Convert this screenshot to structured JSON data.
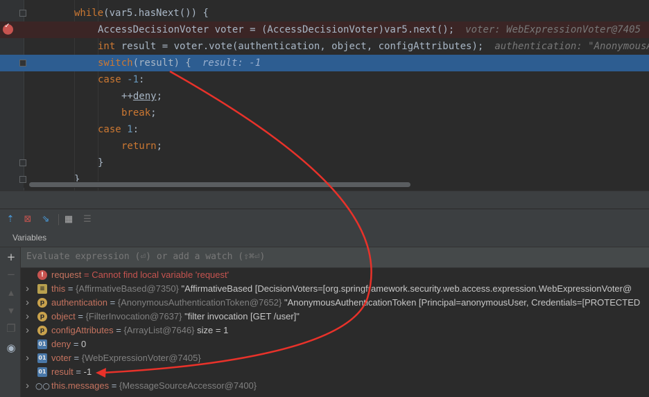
{
  "editor": {
    "lines": [
      {
        "indent": 0,
        "parts": [
          {
            "t": "while",
            "c": "kw"
          },
          {
            "t": "(var5.hasNext()) {"
          }
        ]
      },
      {
        "indent": 1,
        "parts": [
          {
            "t": "AccessDecisionVoter voter = (AccessDecisionVoter)var5.next();"
          }
        ],
        "hint": "voter: WebExpressionVoter@7405"
      },
      {
        "indent": 1,
        "parts": [
          {
            "t": "int",
            "c": "kw"
          },
          {
            "t": " result = voter.vote(authentication, object, configAttributes);"
          }
        ],
        "hint": "authentication: \"AnonymousAuthenticationToken"
      },
      {
        "indent": 1,
        "parts": [
          {
            "t": "switch",
            "c": "kw"
          },
          {
            "t": "(result) {"
          }
        ],
        "hint": "result: -1"
      },
      {
        "indent": 1,
        "parts": [
          {
            "t": "case ",
            "c": "kw"
          },
          {
            "t": "-1",
            "c": "num"
          },
          {
            "t": ":"
          }
        ]
      },
      {
        "indent": 2,
        "parts": [
          {
            "t": "++"
          },
          {
            "t": "deny",
            "c": "fld"
          },
          {
            "t": ";"
          }
        ]
      },
      {
        "indent": 2,
        "parts": [
          {
            "t": "break",
            "c": "kw"
          },
          {
            "t": ";"
          }
        ]
      },
      {
        "indent": 1,
        "parts": [
          {
            "t": "case ",
            "c": "kw"
          },
          {
            "t": "1",
            "c": "num"
          },
          {
            "t": ":"
          }
        ]
      },
      {
        "indent": 2,
        "parts": [
          {
            "t": "return",
            "c": "kw"
          },
          {
            "t": ";"
          }
        ]
      },
      {
        "indent": 1,
        "parts": [
          {
            "t": "}"
          }
        ]
      },
      {
        "indent": 0,
        "parts": [
          {
            "t": "}"
          }
        ]
      }
    ]
  },
  "toolbar": {
    "icons": [
      "step-out-icon",
      "drop-frame-icon",
      "run-to-cursor-icon",
      "evaluate-table-icon",
      "trace-icon"
    ],
    "glyphs": [
      "⇡",
      "⊠",
      "⇘",
      "▦",
      "☰"
    ]
  },
  "variables": {
    "header": "Variables",
    "eval_placeholder": "Evaluate expression (⏎) or add a watch (⇧⌘⏎)",
    "side_icons": [
      {
        "name": "add-watch-icon",
        "glyph": "+"
      },
      {
        "name": "remove-watch-icon",
        "glyph": "−"
      },
      {
        "name": "move-up-icon",
        "glyph": "▴"
      },
      {
        "name": "move-down-icon",
        "glyph": "▾"
      },
      {
        "name": "copy-icon",
        "glyph": "❐"
      },
      {
        "name": "view-icon",
        "glyph": "◉"
      }
    ],
    "rows": [
      {
        "icon": "error",
        "name": "request",
        "text": " = Cannot find local variable 'request'"
      },
      {
        "icon": "field",
        "expand": true,
        "name": "this",
        "type": "{AffirmativeBased@7350}",
        "value": "\"AffirmativeBased [DecisionVoters=[org.springframework.security.web.access.expression.WebExpressionVoter@"
      },
      {
        "icon": "param",
        "expand": true,
        "name": "authentication",
        "type": "{AnonymousAuthenticationToken@7652}",
        "value": "\"AnonymousAuthenticationToken [Principal=anonymousUser, Credentials=[PROTECTED"
      },
      {
        "icon": "param",
        "expand": true,
        "name": "object",
        "type": "{FilterInvocation@7637}",
        "value": "\"filter invocation [GET /user]\""
      },
      {
        "icon": "param",
        "expand": true,
        "name": "configAttributes",
        "type": "{ArrayList@7646}",
        "value": " size = 1"
      },
      {
        "icon": "local",
        "name": "deny",
        "value": "0"
      },
      {
        "icon": "local",
        "expand": true,
        "name": "voter",
        "type": "{WebExpressionVoter@7405}"
      },
      {
        "icon": "local",
        "name": "result",
        "value": "-1"
      },
      {
        "icon": "glasses",
        "expand": true,
        "name": "this.messages",
        "type": "{MessageSourceAccessor@7400}"
      }
    ]
  },
  "colors": {
    "annotation": "#e8322a",
    "selection": "#2d5d91",
    "breakpoint": "#c75450"
  }
}
